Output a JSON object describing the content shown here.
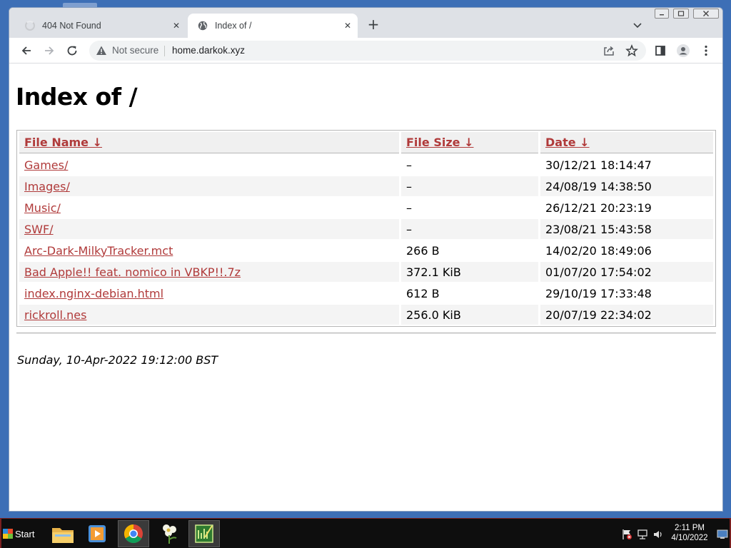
{
  "browser": {
    "tabs": [
      {
        "title": "404 Not Found",
        "favicon": "loading-spinner-icon",
        "active": false
      },
      {
        "title": "Index of /",
        "favicon": "globe-icon",
        "active": true
      }
    ],
    "security_label": "Not secure",
    "url": "home.darkok.xyz"
  },
  "page": {
    "title": "Index of /",
    "columns": [
      "File Name  ↓",
      "File Size  ↓",
      "Date  ↓"
    ],
    "rows": [
      {
        "name": "Games/",
        "size": "–",
        "date": "30/12/21 18:14:47"
      },
      {
        "name": "Images/",
        "size": "–",
        "date": "24/08/19 14:38:50"
      },
      {
        "name": "Music/",
        "size": "–",
        "date": "26/12/21 20:23:19"
      },
      {
        "name": "SWF/",
        "size": "–",
        "date": "23/08/21 15:43:58"
      },
      {
        "name": "Arc-Dark-MilkyTracker.mct",
        "size": "266 B",
        "date": "14/02/20 18:49:06"
      },
      {
        "name": "Bad Apple!! feat. nomico in VBKP!!.7z",
        "size": "372.1 KiB",
        "date": "01/07/20 17:54:02"
      },
      {
        "name": "index.nginx-debian.html",
        "size": "612 B",
        "date": "29/10/19 17:33:48"
      },
      {
        "name": "rickroll.nes",
        "size": "256.0 KiB",
        "date": "20/07/19 22:34:02"
      }
    ],
    "generated": "Sunday, 10-Apr-2022 19:12:00 BST"
  },
  "taskbar": {
    "start_label": "Start",
    "apps": [
      "file-explorer-icon",
      "media-player-icon",
      "chrome-icon",
      "flower-app-icon",
      "tracker-app-icon"
    ],
    "clock_time": "2:11 PM",
    "clock_date": "4/10/2022"
  },
  "colors": {
    "link": "#b03a3a",
    "desktop": "#3d6fb6",
    "taskbar": "#0e0e0e"
  }
}
